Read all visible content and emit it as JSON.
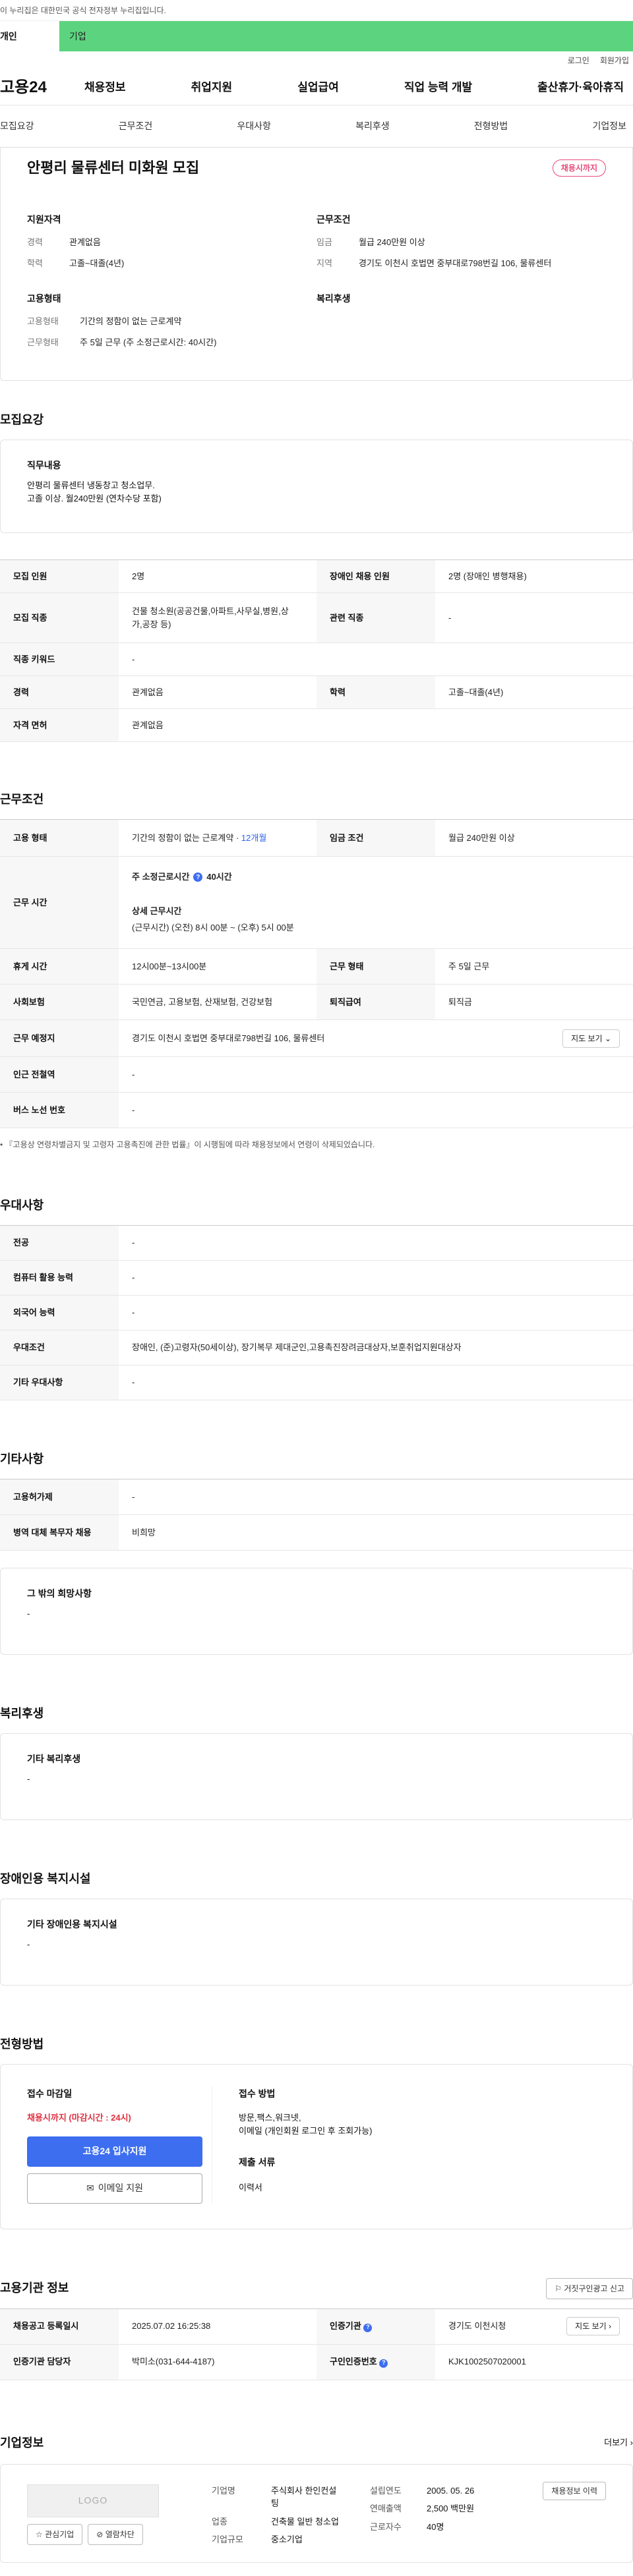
{
  "top_notice": "이 누리집은 대한민국 공식 전자정부 누리집입니다.",
  "user_tabs": [
    "개인",
    "기업"
  ],
  "util": [
    "로그인",
    "회원가입"
  ],
  "logo": "고용24",
  "gnb": [
    "채용정보",
    "취업지원",
    "실업급여",
    "직업 능력 개발",
    "출산휴가·육아휴직"
  ],
  "subtabs": [
    "모집요강",
    "근무조건",
    "우대사항",
    "복리후생",
    "전형방법",
    "기업정보"
  ],
  "header": {
    "title": "안평리 물류센터 미화원 모집",
    "badge": "채용시까지",
    "qual_title": "지원자격",
    "qual": [
      {
        "k": "경력",
        "v": "관계없음"
      },
      {
        "k": "학력",
        "v": "고졸~대졸(4년)"
      }
    ],
    "cond_title": "근무조건",
    "cond": [
      {
        "k": "임금",
        "v": "월급 240만원 이상"
      },
      {
        "k": "지역",
        "v": "경기도 이천시 호법면 중부대로798번길 106, 물류센터"
      }
    ],
    "emp_title": "고용형태",
    "emp": [
      {
        "k": "고용형태",
        "v": "기간의 정함이 없는 근로계약"
      },
      {
        "k": "근무형태",
        "v": "주 5일 근무 (주 소정근로시간: 40시간)"
      }
    ],
    "welfare_title": "복리후생"
  },
  "recruit": {
    "title": "모집요강",
    "duty_title": "직무내용",
    "duty_text1": "안평리 물류센터 냉동창고 청소업무.",
    "duty_text2": "고졸 이상. 월240만원 (연차수당 포함)",
    "rows": [
      [
        "모집 인원",
        "2명",
        "장애인 채용 인원",
        "2명 (장애인 병행채용)"
      ],
      [
        "모집 직종",
        "건물 청소원(공공건물,아파트,사무실,병원,상가,공장 등)",
        "관련 직종",
        "-"
      ],
      [
        "직종 키워드",
        "-",
        "",
        ""
      ],
      [
        "경력",
        "관계없음",
        "학력",
        "고졸~대졸(4년)"
      ],
      [
        "자격 면허",
        "관계없음",
        "",
        ""
      ]
    ]
  },
  "work": {
    "title": "근무조건",
    "emp_label": "고용 형태",
    "emp_value": "기간의 정함이 없는 근로계약 · ",
    "emp_months": "12개월",
    "wage_label": "임금 조건",
    "wage_value": "월급 240만원 이상",
    "time_label": "근무 시간",
    "time_main": "주 소정근로시간",
    "time_hours": "40시간",
    "time_detail_title": "상세 근무시간",
    "time_detail": "(근무시간) (오전) 8시 00분 ~ (오후) 5시 00분",
    "rest_label": "휴게 시간",
    "rest_value": "12시00분~13시00분",
    "shift_label": "근무 형태",
    "shift_value": "주 5일 근무",
    "ins_label": "사회보험",
    "ins_value": "국민연금, 고용보험, 산재보험, 건강보험",
    "sev_label": "퇴직급여",
    "sev_value": "퇴직금",
    "place_label": "근무 예정지",
    "place_value": "경기도 이천시 호법면 중부대로798번길 106, 물류센터",
    "map_btn": "지도 보기",
    "station_label": "인근 전철역",
    "station_value": "-",
    "bus_label": "버스 노선 번호",
    "bus_value": "-",
    "note": "『고용상 연령차별금지 및 고령자 고용촉진에 관한 법률』이 시행됨에 따라 채용정보에서 연령이 삭제되었습니다."
  },
  "pref": {
    "title": "우대사항",
    "rows": [
      [
        "전공",
        "-"
      ],
      [
        "컴퓨터 활용 능력",
        "-"
      ],
      [
        "외국어 능력",
        "-"
      ],
      [
        "우대조건",
        "장애인, (준)고령자(50세이상), 장기복무 제대군인,고용촉진장려금대상자,보훈취업지원대상자"
      ],
      [
        "기타 우대사항",
        "-"
      ]
    ]
  },
  "etc": {
    "title": "기타사항",
    "rows": [
      [
        "고용허가제",
        "-"
      ],
      [
        "병역 대체 복무자 채용",
        "비희망"
      ]
    ],
    "wish_title": "그 밖의 희망사항",
    "wish_value": "-"
  },
  "welfare": {
    "title": "복리후생",
    "box_title": "기타 복리후생",
    "box_value": "-"
  },
  "disabled": {
    "title": "장애인용 복지시설",
    "box_title": "기타 장애인용 복지시설",
    "box_value": "-"
  },
  "process": {
    "title": "전형방법",
    "deadline_title": "접수 마감일",
    "deadline_value": "채용시까지 (마감시간 : 24시)",
    "apply_btn": "고용24 입사지원",
    "email_btn": "이메일 지원",
    "method_title": "접수 방법",
    "method_1": "방문,팩스,워크넷,",
    "method_2": "이메일 (개인회원 로그인 후 조회가능)",
    "docs_title": "제출 서류",
    "docs_value": "이력서"
  },
  "agency": {
    "title": "고용기관 정보",
    "report_btn": "거짓구인광고 신고",
    "reg_label": "채용공고 등록일시",
    "reg_value": "2025.07.02 16:25:38",
    "org_label": "인증기관",
    "org_value": "경기도 이천시청",
    "map_btn": "지도 보기",
    "staff_label": "인증기관 담당자",
    "staff_value": "박미소(031-644-4187)",
    "cert_label": "구인인증번호",
    "cert_value": "KJK1002507020001"
  },
  "company": {
    "title": "기업정보",
    "more": "더보기",
    "logo_text": "LOGO",
    "fav_btn": "관심기업",
    "block_btn": "열람차단",
    "name_label": "기업명",
    "name_value": "주식회사 한인컨설팅",
    "biz_label": "업종",
    "biz_value": "건축물 일반 청소업",
    "size_label": "기업규모",
    "size_value": "중소기업",
    "year_label": "설립연도",
    "year_value": "2005. 05. 26",
    "sales_label": "연매출액",
    "sales_value": "2,500 백만원",
    "emp_label": "근로자수",
    "emp_value": "40명",
    "history_btn": "채용정보 이력"
  },
  "colors": {
    "green": "#5cd47f",
    "blue": "#3d6ef0",
    "pink": "#e84a7a",
    "red": "#e03040"
  }
}
